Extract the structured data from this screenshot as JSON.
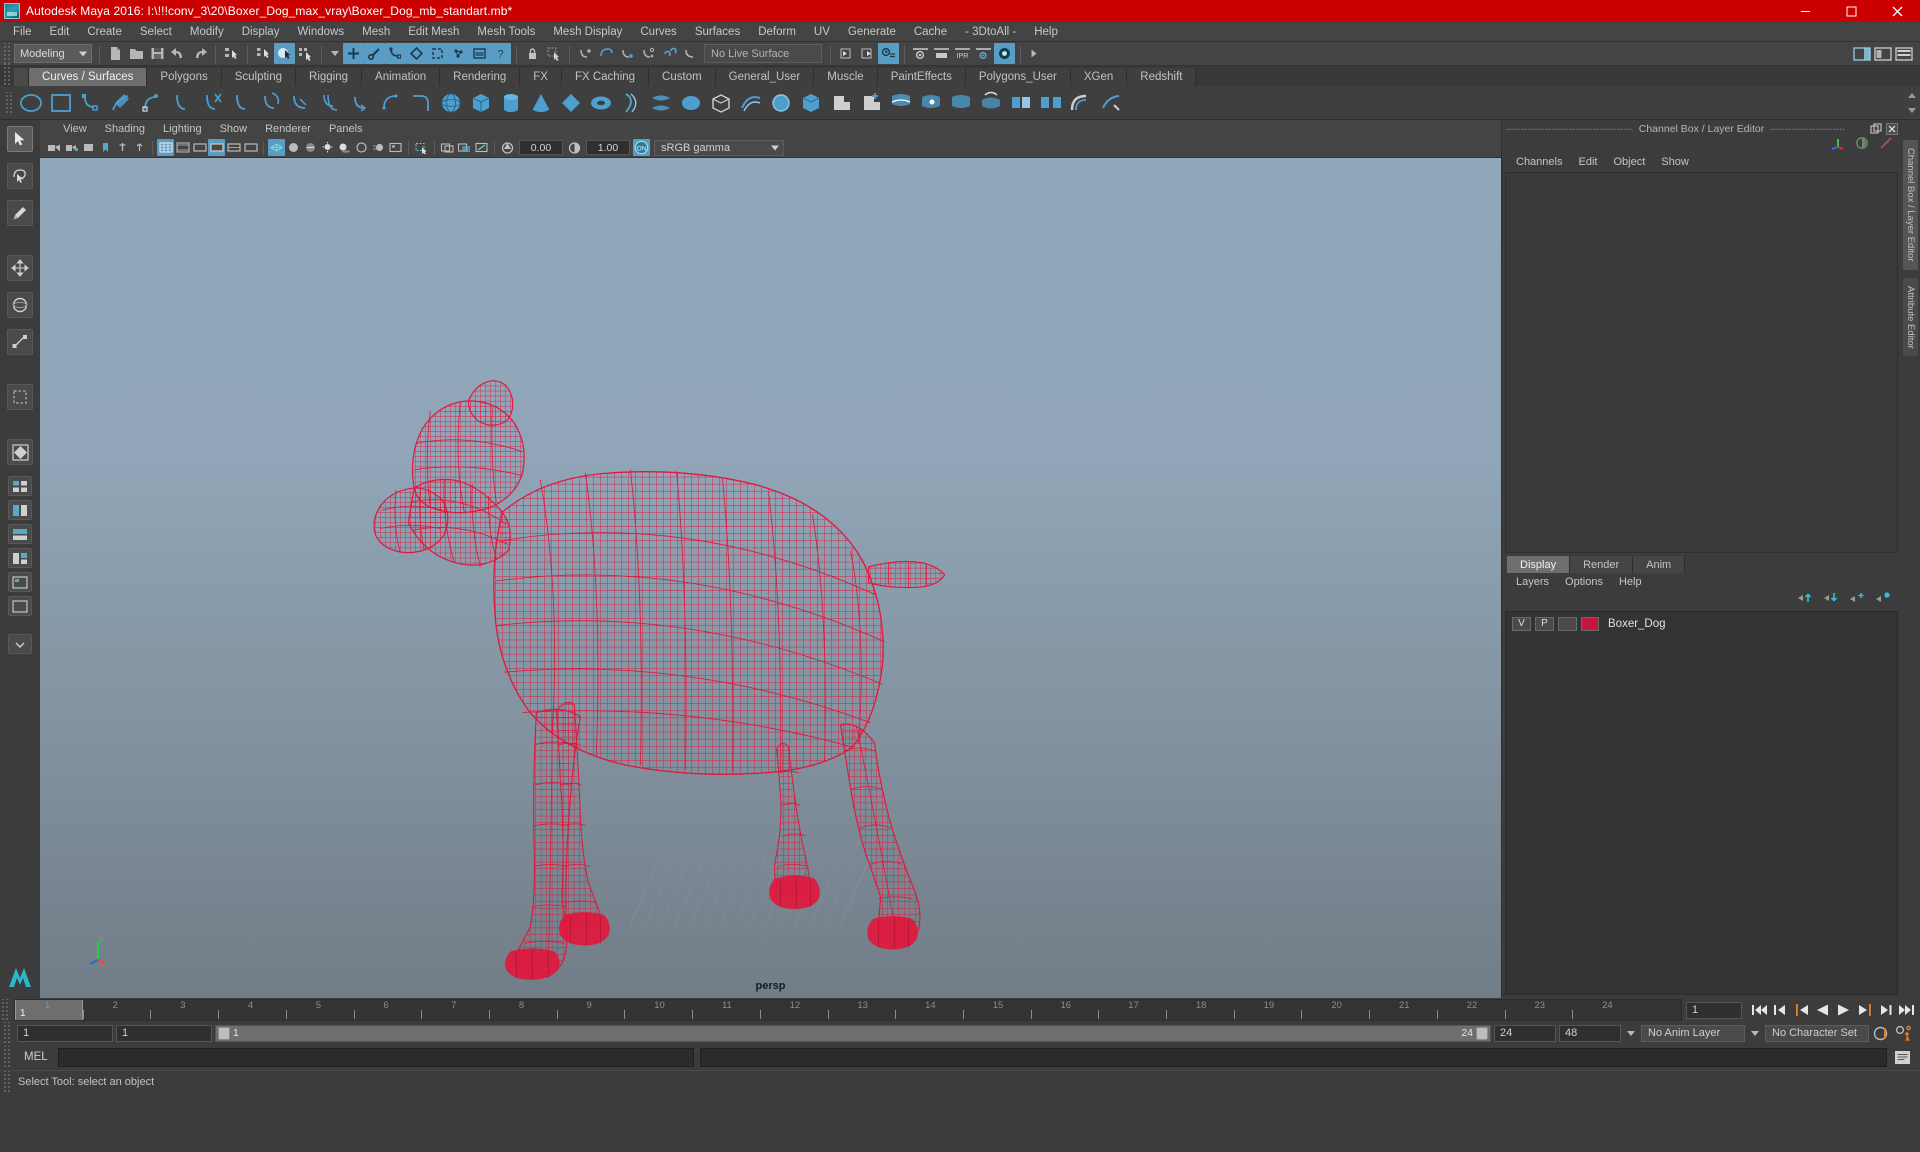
{
  "window": {
    "title": "Autodesk Maya 2016: I:\\!!!conv_3\\20\\Boxer_Dog_max_vray\\Boxer_Dog_mb_standart.mb*",
    "app_icon": "maya-app-icon",
    "minimize": "–",
    "maximize": "❐",
    "close": "✕"
  },
  "menubar": {
    "items": [
      "File",
      "Edit",
      "Create",
      "Select",
      "Modify",
      "Display",
      "Windows",
      "Mesh",
      "Edit Mesh",
      "Mesh Tools",
      "Mesh Display",
      "Curves",
      "Surfaces",
      "Deform",
      "UV",
      "Generate",
      "Cache",
      "- 3DtoAll -",
      "Help"
    ]
  },
  "statusline": {
    "menuset": "Modeling",
    "live_surface": "No Live Surface",
    "icons": [
      "new-scene-icon",
      "open-scene-icon",
      "save-scene-icon",
      "undo-icon",
      "redo-icon",
      "select-hierarchy-icon",
      "select-object-icon",
      "select-component-icon",
      "select-by-type-icon",
      "snap-to-grid-icon",
      "snap-to-curve-icon",
      "snap-to-point-icon",
      "snap-to-projected-center-icon",
      "snap-to-view-plane-icon",
      "make-live-icon",
      "lock-icon",
      "render-view-icon",
      "open-render-view-icon",
      "render-current-frame-icon",
      "ipr-render-icon",
      "render-settings-icon",
      "hypershade-icon"
    ]
  },
  "shelf": {
    "tabs": [
      "Curves / Surfaces",
      "Polygons",
      "Sculpting",
      "Rigging",
      "Animation",
      "Rendering",
      "FX",
      "FX Caching",
      "Custom",
      "General_User",
      "Muscle",
      "PaintEffects",
      "Polygons_User",
      "XGen",
      "Redshift"
    ],
    "active_tab": "Curves / Surfaces",
    "icons": [
      "nurbs-circle-icon",
      "nurbs-square-icon",
      "ep-curve-tool-icon",
      "pencil-curve-tool-icon",
      "bezier-curve-tool-icon",
      "attach-curve-icon",
      "detach-curve-icon",
      "cut-curve-icon",
      "align-curve-icon",
      "open-close-curve-icon",
      "insert-knot-icon",
      "offset-curve-icon",
      "reverse-curve-icon",
      "rebuild-curve-icon",
      "nurbs-sphere-icon",
      "nurbs-cube-icon",
      "nurbs-cylinder-icon",
      "nurbs-cone-icon",
      "nurbs-plane-icon",
      "nurbs-torus-icon",
      "revolve-icon",
      "loft-icon",
      "planar-icon",
      "extrude-icon",
      "birail-icon",
      "boundary-icon",
      "square-surface-icon",
      "bevel-icon",
      "bevel-plus-icon",
      "intersect-surfaces-icon",
      "trim-tool-icon",
      "untrim-surfaces-icon",
      "project-curve-icon",
      "attach-surfaces-icon",
      "detach-surfaces-icon",
      "align-surfaces-icon",
      "surface-fillet-icon"
    ]
  },
  "toolbox": {
    "tools": [
      "select-tool",
      "lasso-select-tool",
      "paint-select-tool",
      "move-tool",
      "rotate-tool",
      "scale-tool",
      "last-tool-used",
      "quick-layout-persp",
      "quick-layout-fourview",
      "quick-layout-outliner",
      "quick-layout-hypergraph",
      "quick-layout-graph-editor",
      "quick-layout-uv-editor",
      "quick-layout-extra"
    ],
    "selected": "select-tool",
    "logo": "maya-logo-icon"
  },
  "viewport": {
    "menus": [
      "View",
      "Shading",
      "Lighting",
      "Show",
      "Renderer",
      "Panels"
    ],
    "camera_label": "persp",
    "exposure": "0.00",
    "gamma": "1.00",
    "color_management": "sRGB gamma",
    "view_transform_enabled": "ON",
    "toolbar_icons": [
      "select-camera-icon",
      "lock-camera-icon",
      "camera-attributes-icon",
      "bookmark-icon",
      "image-plane-icon",
      "two-sided-lighting-icon",
      "shadows-icon",
      "grid-toggle-icon",
      "film-gate-icon",
      "resolution-gate-icon",
      "gate-mask-icon",
      "xray-toggle-icon",
      "xray-joints-icon",
      "wireframe-icon",
      "smooth-shade-all-icon",
      "smooth-shade-textured-icon",
      "use-all-lights-icon",
      "shadow-toggle-icon",
      "ambient-occlusion-icon",
      "motion-blur-icon",
      "multisample-icon",
      "isolate-select-icon",
      "snapshot-icon",
      "exposure-icon",
      "contrast-icon",
      "view-transform-icon"
    ],
    "model": {
      "name": "Boxer_Dog",
      "wireframe_color": "#e0183c",
      "background_top": "#8fa7bb",
      "background_bottom": "#74808a"
    }
  },
  "channel_box": {
    "panel_title": "Channel Box / Layer Editor",
    "menus": [
      "Channels",
      "Edit",
      "Object",
      "Show"
    ],
    "header_icons": [
      "transform-axis-icon",
      "display-render-stats-icon",
      "attribute-editor-icon"
    ],
    "dock_buttons": [
      "undock-icon",
      "close-icon"
    ]
  },
  "layer_editor": {
    "tabs": [
      "Display",
      "Render",
      "Anim"
    ],
    "active_tab": "Display",
    "menus": [
      "Layers",
      "Options",
      "Help"
    ],
    "buttons": [
      "move-layer-up-icon",
      "move-layer-down-icon",
      "new-layer-icon",
      "new-layer-from-selected-icon"
    ],
    "layers": [
      {
        "visibility": "V",
        "playback": "P",
        "type": "",
        "color": "#c4153c",
        "name": "Boxer_Dog"
      }
    ]
  },
  "right_tabs": {
    "vertical": [
      "Channel Box / Layer Editor",
      "Attribute Editor"
    ]
  },
  "timeline": {
    "ticks": [
      "1",
      "2",
      "3",
      "4",
      "5",
      "6",
      "7",
      "8",
      "9",
      "10",
      "11",
      "12",
      "13",
      "14",
      "15",
      "16",
      "17",
      "18",
      "19",
      "20",
      "21",
      "22",
      "23",
      "24"
    ],
    "current_frame": "1",
    "current_frame_field": "1",
    "playback_buttons": [
      "go-to-start-icon",
      "step-back-keyframe-icon",
      "step-back-frame-icon",
      "play-backwards-icon",
      "play-forwards-icon",
      "step-forward-frame-icon",
      "step-forward-keyframe-icon",
      "go-to-end-icon"
    ]
  },
  "range_slider": {
    "start_field": "1",
    "anim_start_field": "1",
    "range_start_label": "1",
    "range_end_label": "24",
    "anim_end_field": "24",
    "end_field": "48",
    "anim_layer": "No Anim Layer",
    "character_set": "No Character Set",
    "auto_keyframe_icon": "auto-keyframe-icon",
    "anim_prefs_icon": "animation-preferences-icon"
  },
  "command_line": {
    "language_label": "MEL",
    "input_value": "",
    "input_placeholder": "",
    "script_editor_icon": "script-editor-icon"
  },
  "status_bar": {
    "message": "Select Tool: select an object"
  }
}
